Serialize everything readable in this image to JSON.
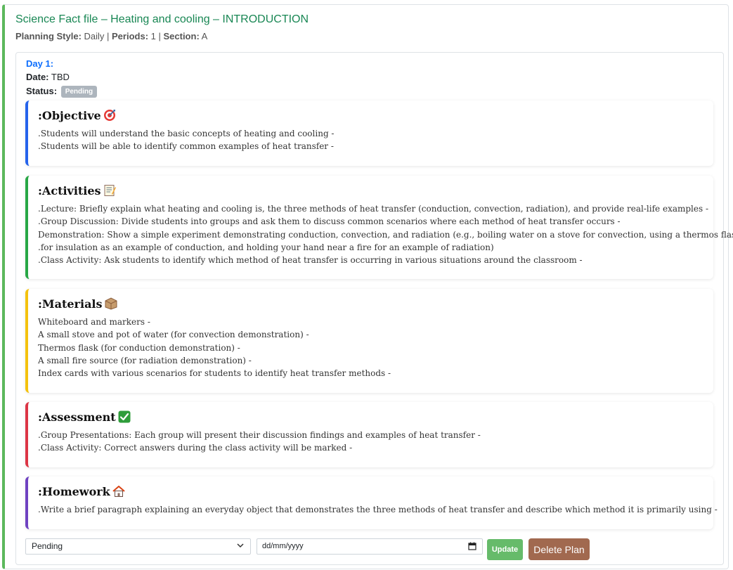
{
  "plan": {
    "title": "Science Fact file – Heating and cooling – INTRODUCTION",
    "meta": {
      "planning_style_label": "Planning Style:",
      "planning_style_value": " Daily | ",
      "periods_label": "Periods:",
      "periods_value": " 1 | ",
      "section_label": "Section:",
      "section_value": " A"
    }
  },
  "day": {
    "label": "Day 1:",
    "date_label": "Date:",
    "date_value": " TBD",
    "status_label": "Status:",
    "status_badge": "Pending"
  },
  "sections": {
    "objective": {
      "heading": ":Objective",
      "icon": "target-icon",
      "color": "#2563eb",
      "lines": [
        ".Students will understand the basic concepts of heating and cooling -",
        ".Students will be able to identify common examples of heat transfer -"
      ]
    },
    "activities": {
      "heading": ":Activities",
      "icon": "memo-icon",
      "color": "#28a745",
      "lines": [
        ".Lecture: Briefly explain what heating and cooling is, the three methods of heat transfer (conduction, convection, radiation), and provide real-life examples -",
        ".Group Discussion: Divide students into groups and ask them to discuss common scenarios where each method of heat transfer occurs -",
        "Demonstration: Show a simple experiment demonstrating conduction, convection, and radiation (e.g., boiling water on a stove for convection, using a thermos flask -",
        ".for insulation as an example of conduction, and holding your hand near a fire for an example of radiation)",
        ".Class Activity: Ask students to identify which method of heat transfer is occurring in various situations around the classroom -"
      ]
    },
    "materials": {
      "heading": ":Materials",
      "icon": "package-icon",
      "color": "#f4c20d",
      "lines": [
        "Whiteboard and markers -",
        "A small stove and pot of water (for convection demonstration) -",
        "Thermos flask (for conduction demonstration) -",
        "A small fire source (for radiation demonstration) -",
        "Index cards with various scenarios for students to identify heat transfer methods -"
      ]
    },
    "assessment": {
      "heading": ":Assessment",
      "icon": "check-mark-icon",
      "color": "#dc3545",
      "lines": [
        ".Group Presentations: Each group will present their discussion findings and examples of heat transfer -",
        ".Class Activity: Correct answers during the class activity will be marked -"
      ]
    },
    "homework": {
      "heading": ":Homework",
      "icon": "house-icon",
      "color": "#6f42c1",
      "lines": [
        ".Write a brief paragraph explaining an everyday object that demonstrates the three methods of heat transfer and describe which method it is primarily using -"
      ]
    }
  },
  "controls": {
    "status_select_value": "Pending",
    "date_placeholder": "dd/mm/yyyy",
    "update_label": "Update",
    "delete_label": "Delete Plan"
  }
}
